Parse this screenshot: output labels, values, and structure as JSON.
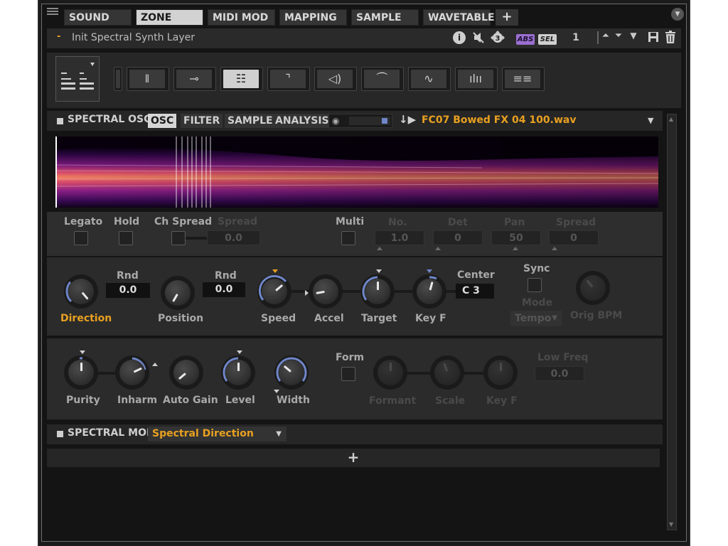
{
  "tabs": [
    "SOUND",
    "ZONE",
    "MIDI MOD",
    "MAPPING",
    "SAMPLE",
    "WAVETABLE"
  ],
  "tab_add": "+",
  "layer": {
    "dash": "-",
    "name": "Init Spectral Synth Layer",
    "abs": "ABS",
    "sel": "SEL",
    "number": "1"
  },
  "osc_section": {
    "title": "SPECTRAL OSC",
    "subtabs": [
      "OSC",
      "FILTER",
      "SAMPLE",
      "ANALYSIS"
    ],
    "filename": "FC07 Bowed FX 04 100.wav"
  },
  "row1": {
    "legato": "Legato",
    "hold": "Hold",
    "ch_spread": "Ch Spread",
    "spread": "Spread",
    "spread_value": "0.0",
    "multi": "Multi",
    "no": "No.",
    "no_value": "1.0",
    "det": "Det",
    "det_value": "0",
    "pan": "Pan",
    "pan_value": "50",
    "spread2": "Spread",
    "spread2_value": "0"
  },
  "row2": {
    "rnd1": "Rnd",
    "rnd1_value": "0.0",
    "rnd2": "Rnd",
    "rnd2_value": "0.0",
    "direction": "Direction",
    "position": "Position",
    "speed": "Speed",
    "accel": "Accel",
    "target": "Target",
    "keyf": "Key F",
    "center": "Center",
    "center_value": "C 3",
    "sync": "Sync",
    "mode": "Mode",
    "mode_value": "Tempo",
    "orig_bpm": "Orig BPM"
  },
  "row3": {
    "purity": "Purity",
    "inharm": "Inharm",
    "auto_gain": "Auto Gain",
    "level": "Level",
    "width": "Width",
    "form": "Form",
    "formant": "Formant",
    "scale": "Scale",
    "keyf": "Key F",
    "low_freq": "Low Freq",
    "low_freq_value": "0.0"
  },
  "mod_section": {
    "title": "SPECTRAL MOD",
    "dropdown": "Spectral Direction",
    "add": "+"
  },
  "colors": {
    "accent": "#e8a020",
    "knob_arc": "#6f86c9",
    "panel": "#2b2b2b"
  }
}
